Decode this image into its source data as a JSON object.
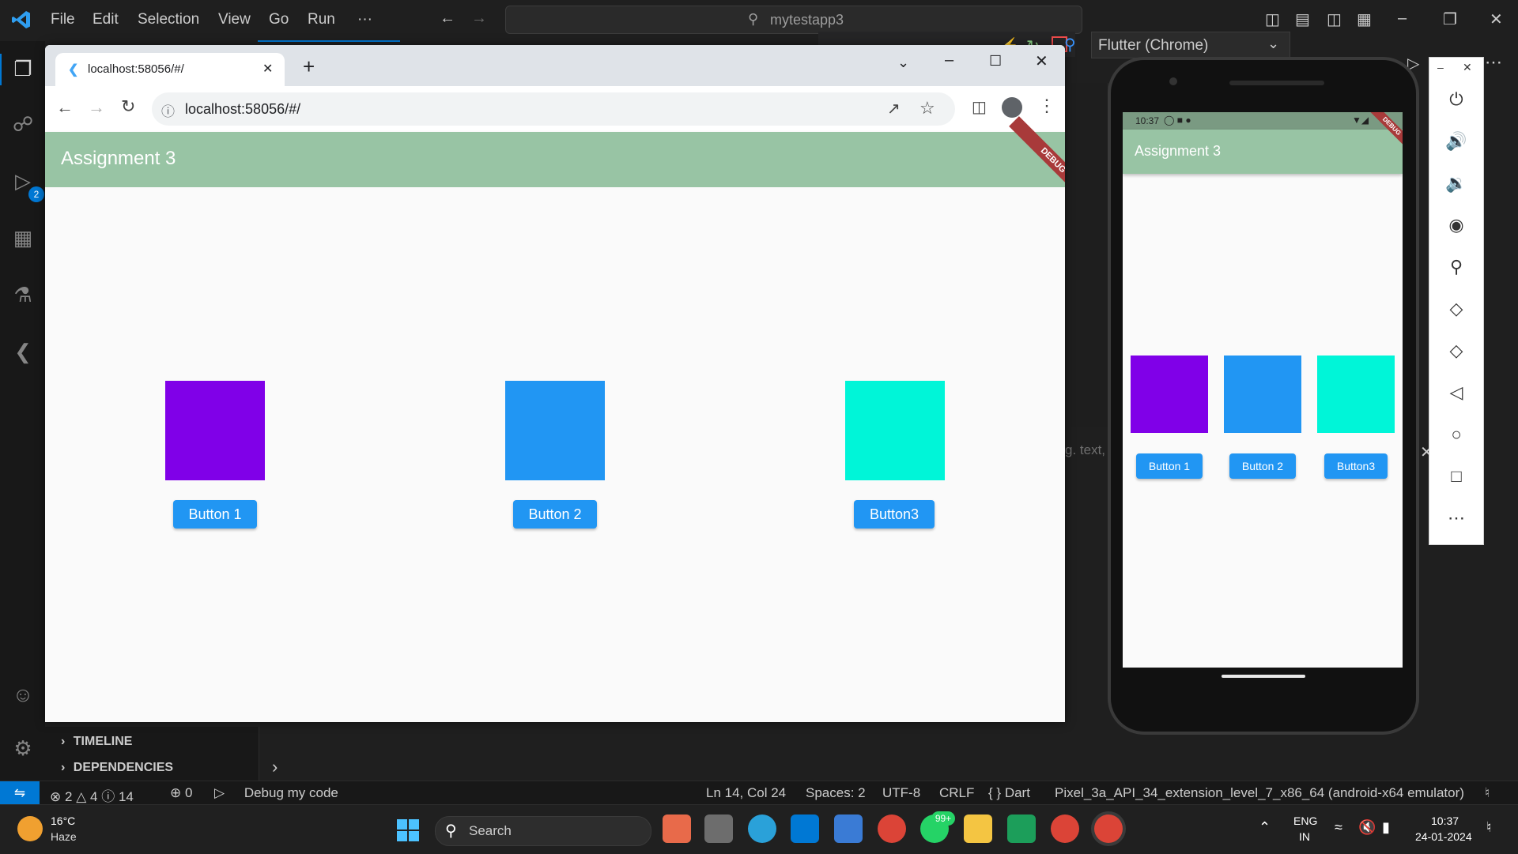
{
  "vscode": {
    "menu": [
      "File",
      "Edit",
      "Selection",
      "View",
      "Go",
      "Run",
      "···"
    ],
    "search_text": "mytestapp3",
    "device_select": "Flutter (Chrome)",
    "debug_badge": "2",
    "panel": {
      "timeline": "TIMELINE",
      "dependencies": "DEPENDENCIES"
    },
    "partial_text": "g. text,",
    "status": {
      "errors": "2",
      "warnings": "4",
      "infos": "14",
      "ports": "0",
      "debug_label": "Debug my code",
      "position": "Ln 14, Col 24",
      "spaces": "Spaces: 2",
      "encoding": "UTF-8",
      "eol": "CRLF",
      "language": "Dart",
      "device": "Pixel_3a_API_34_extension_level_7_x86_64 (android-x64 emulator)"
    }
  },
  "chrome": {
    "tab_title": "localhost:58056/#/",
    "url": "localhost:58056/#/"
  },
  "app": {
    "title": "Assignment 3",
    "debug_label": "DEBUG",
    "boxes": [
      {
        "color": "#8000e8",
        "button": "Button 1"
      },
      {
        "color": "#2196f3",
        "button": "Button 2"
      },
      {
        "color": "#00f5d8",
        "button": "Button3"
      }
    ]
  },
  "phone": {
    "time": "10:37",
    "title": "Assignment 3",
    "debug_label": "DEBUG"
  },
  "taskbar": {
    "weather_temp": "16°C",
    "weather_desc": "Haze",
    "search_label": "Search",
    "whatsapp_badge": "99+",
    "lang_top": "ENG",
    "lang_bottom": "IN",
    "clock_time": "10:37",
    "clock_date": "24-01-2024"
  }
}
